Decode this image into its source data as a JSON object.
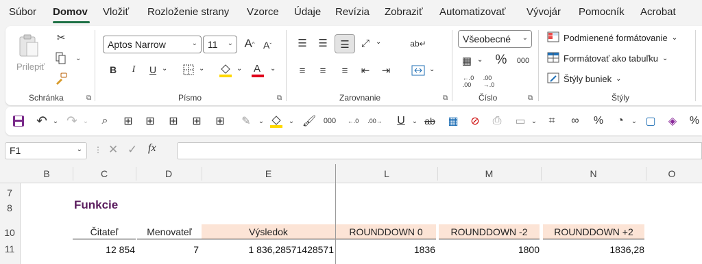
{
  "menu": {
    "tabs": [
      "Súbor",
      "Domov",
      "Vložiť",
      "Rozloženie strany",
      "Vzorce",
      "Údaje",
      "Revízia",
      "Zobraziť",
      "Automatizovať",
      "Vývojár",
      "Pomocník",
      "Acrobat"
    ],
    "active": "Domov"
  },
  "ribbon": {
    "clipboard": {
      "paste_label": "Prilepiť",
      "group_label": "Schránka"
    },
    "font": {
      "font_name": "Aptos Narrow",
      "font_size": "11",
      "bold": "B",
      "italic": "I",
      "underline": "U",
      "group_label": "Písmo",
      "fill_color": "#ffd800",
      "font_color": "#e0001b"
    },
    "alignment": {
      "group_label": "Zarovnanie"
    },
    "number": {
      "format": "Všeobecné",
      "percent": "%",
      "thousands": "000",
      "group_label": "Číslo"
    },
    "styles": {
      "conditional": "Podmienené formátovanie",
      "as_table": "Formátovať ako tabuľku",
      "cell_styles": "Štýly buniek",
      "group_label": "Štýly"
    }
  },
  "formula_bar": {
    "name_box": "F1",
    "fx": "fx",
    "content": ""
  },
  "sheet": {
    "columns": [
      "B",
      "C",
      "D",
      "E",
      "L",
      "M",
      "N",
      "O"
    ],
    "rows": [
      "7",
      "8",
      "10",
      "11"
    ],
    "title": "Funkcie",
    "headers": [
      "Čitateľ",
      "Menovateľ",
      "Výsledok",
      "ROUNDDOWN 0",
      "ROUNDDOWN -2",
      "ROUNDDOWN +2"
    ],
    "values": [
      "12 854",
      "7",
      "1 836,28571428571",
      "1836",
      "1800",
      "1836,28"
    ],
    "title_color": "#5b1d5e",
    "header_fill": "#fce4d6"
  },
  "qat": {
    "thousands": "000"
  }
}
